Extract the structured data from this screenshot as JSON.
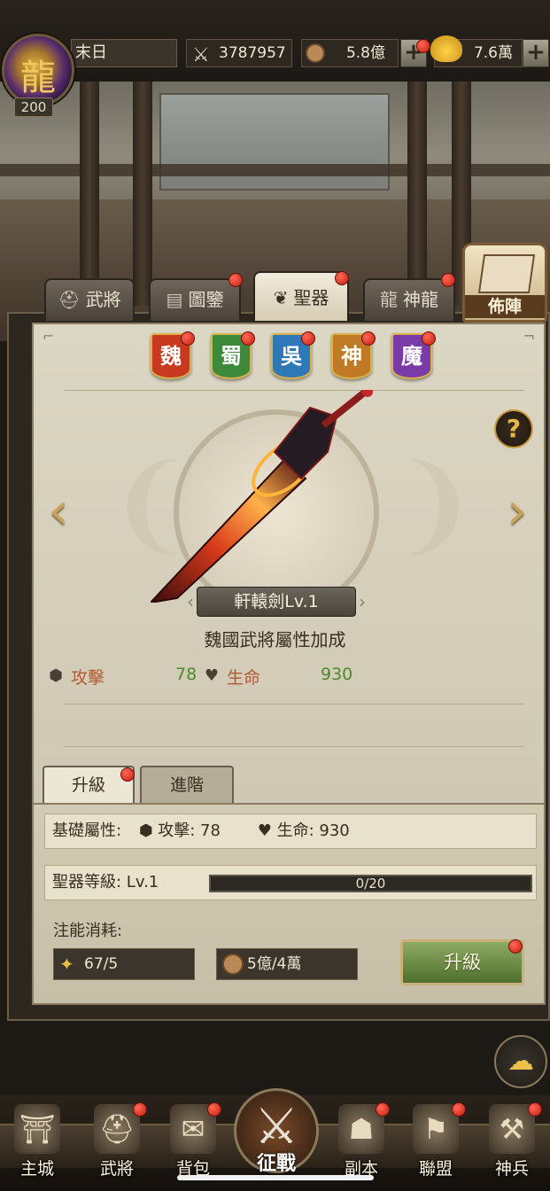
{
  "player": {
    "name": "末日",
    "level": "200",
    "power": "3787957",
    "copper": "5.8億",
    "gold": "7.6萬"
  },
  "tabs": [
    {
      "label": "武將",
      "icon": "helmet-icon"
    },
    {
      "label": "圖鑒",
      "icon": "book-icon"
    },
    {
      "label": "聖器",
      "icon": "leaf-icon"
    },
    {
      "label": "神龍",
      "icon": "dragon-icon"
    }
  ],
  "formation_label": "佈陣",
  "factions": [
    {
      "label": "魏",
      "color": "#c8391f"
    },
    {
      "label": "蜀",
      "color": "#3d8a3a"
    },
    {
      "label": "吳",
      "color": "#2f78b8"
    },
    {
      "label": "神",
      "color": "#c07a25"
    },
    {
      "label": "魔",
      "color": "#7a3aa8"
    }
  ],
  "artifact": {
    "name": "軒轅劍Lv.1",
    "bonus_text": "魏國武將屬性加成",
    "attack_label": "攻擊",
    "attack_value": "78",
    "hp_label": "生命",
    "hp_value": "930"
  },
  "subtabs": {
    "upgrade": "升級",
    "advance": "進階"
  },
  "details": {
    "base_label": "基礎屬性:",
    "base_attack": "攻擊: 78",
    "base_hp": "生命: 930",
    "level_label": "聖器等級: Lv.1",
    "progress_text": "0/20",
    "progress": 0,
    "cost_label": "注能消耗:",
    "cost_crystal": "67/5",
    "cost_copper": "5億/4萬",
    "upgrade_button": "升級"
  },
  "nav": [
    "主城",
    "武將",
    "背包",
    "征戰",
    "副本",
    "聯盟",
    "神兵"
  ],
  "colors": {
    "alert_dot": "#d8261a",
    "upgrade_green": "#6a8f3c",
    "gold_text": "#e6b94a"
  }
}
